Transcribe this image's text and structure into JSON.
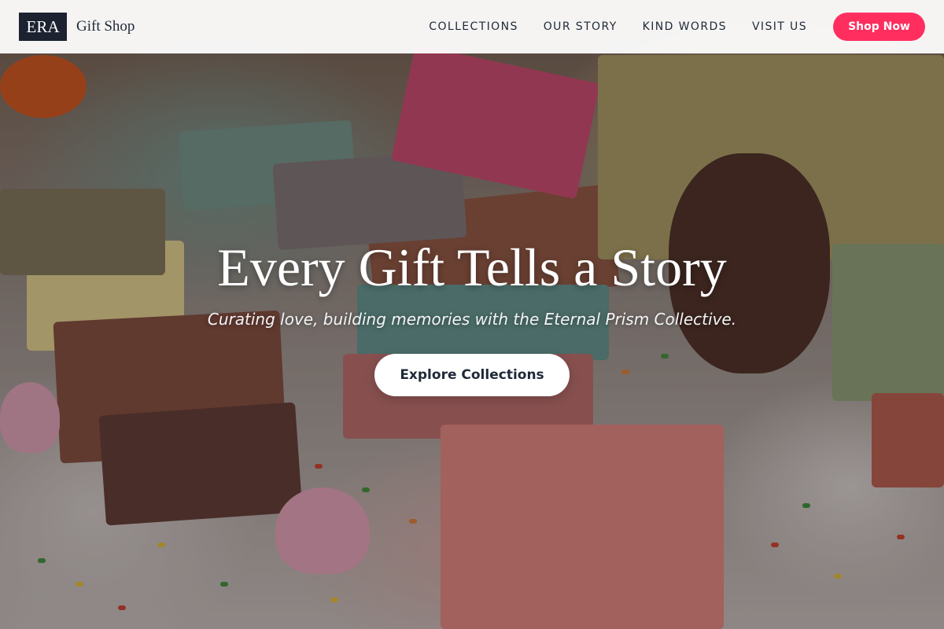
{
  "nav": {
    "logo_text": "ERA",
    "brand_name": "Gift Shop",
    "links": [
      {
        "label": "COLLECTIONS"
      },
      {
        "label": "OUR STORY"
      },
      {
        "label": "KIND WORDS"
      },
      {
        "label": "VISIT US"
      }
    ],
    "cta_label": "Shop Now",
    "cta_color": "#ff2e5f"
  },
  "hero": {
    "title": "Every Gift Tells a Story",
    "subtitle": "Curating love, building memories with the Eternal Prism Collective.",
    "button_label": "Explore Collections"
  },
  "colors": {
    "accent": "#ff2e5f",
    "logo_bg": "#1c2230",
    "text_dark": "#1f2937"
  }
}
